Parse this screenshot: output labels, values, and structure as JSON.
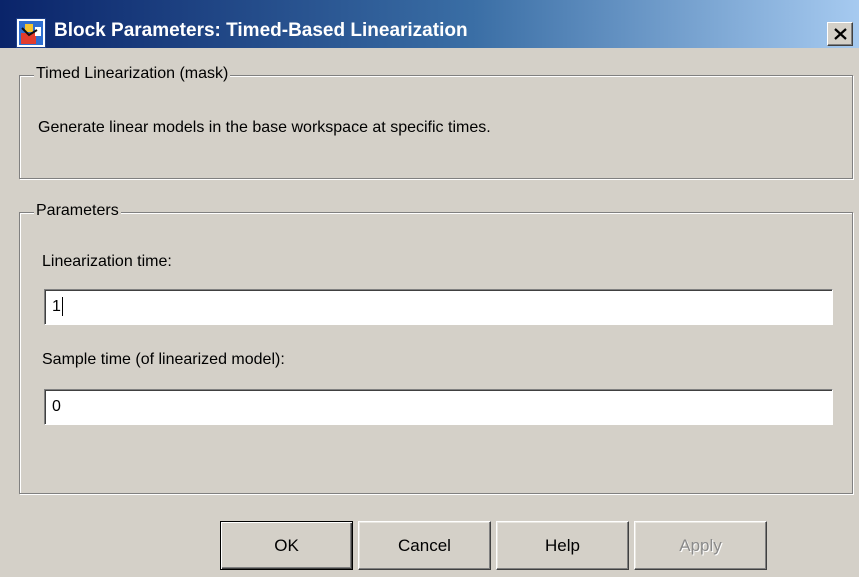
{
  "window": {
    "title": "Block Parameters: Timed-Based Linearization",
    "icon": "simulink-block-icon",
    "close_icon": "close-icon"
  },
  "mask_group": {
    "legend": "Timed Linearization (mask)",
    "description": "Generate linear models in the base workspace at specific times."
  },
  "parameters_group": {
    "legend": "Parameters",
    "linearization_time": {
      "label": "Linearization time:",
      "value": "1"
    },
    "sample_time": {
      "label": "Sample time (of linearized model):",
      "value": "0"
    }
  },
  "buttons": {
    "ok": "OK",
    "cancel": "Cancel",
    "help": "Help",
    "apply": "Apply",
    "apply_enabled": false
  }
}
